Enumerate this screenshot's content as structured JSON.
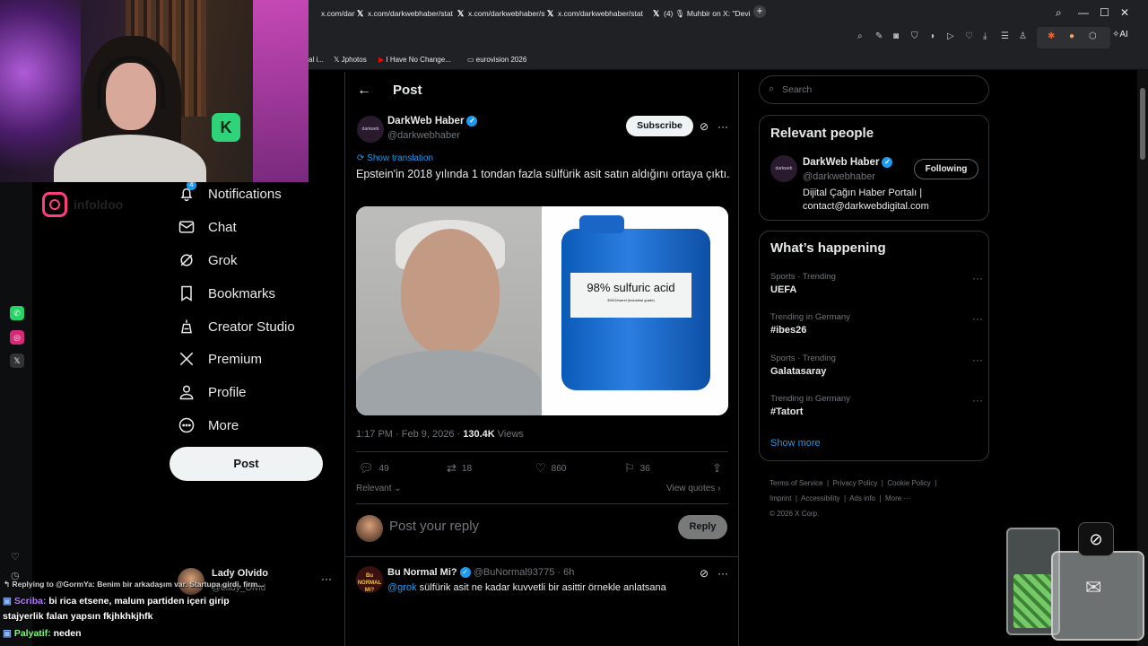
{
  "browser": {
    "tabs": [
      {
        "label": "x.com/darkwebhaber/stat"
      },
      {
        "label": "x.com/darkwebhaber/stat"
      },
      {
        "label": "x.com/darkwebhaber/stat"
      },
      {
        "label": "x.com/darkwebhaber/stat"
      },
      {
        "label": "(4) 🎙 Muhbir on X: \"Devi"
      }
    ],
    "bookmarks": [
      "al i...",
      "Jphotos",
      "I Have No Change...",
      "eurovision 2026"
    ],
    "ai_label": "AI"
  },
  "nav": {
    "notifications": "Notifications",
    "notifications_badge": "4",
    "chat": "Chat",
    "grok": "Grok",
    "bookmarks": "Bookmarks",
    "creator_studio": "Creator Studio",
    "premium": "Premium",
    "profile": "Profile",
    "more": "More",
    "post_button": "Post"
  },
  "me": {
    "name": "Lady Olvido",
    "handle": "@Lady_Olvid"
  },
  "page": {
    "title": "Post"
  },
  "tweet": {
    "author_name": "DarkWeb Haber",
    "author_handle": "@darkwebhaber",
    "avatar_text": "darkweb",
    "subscribe_label": "Subscribe",
    "show_translation": "Show translation",
    "text": "Epstein'in 2018 yılında 1 tondan fazla sülfürik asit satın aldığını ortaya çıktı.",
    "image_label_big": "98% sulfuric acid",
    "image_label_small": "35KG/barrel (industrial grade)",
    "time": "1:17 PM · Feb 9, 2026 · ",
    "views_count": "130.4K",
    "views_label": " Views",
    "replies": "49",
    "reposts": "18",
    "likes": "860",
    "bookmarks": "36",
    "sort_label": "Relevant",
    "view_quotes": "View quotes"
  },
  "reply_box": {
    "placeholder": "Post your reply",
    "button": "Reply"
  },
  "reply": {
    "name": "Bu Normal Mi?",
    "handle": "@BuNormal93775",
    "time": "· 6h",
    "mention": "@grok",
    "text": " sülfürik asit ne kadar kuvvetli bir asittir örnekle anlatsana",
    "avatar_text": "Bu NORMAL Mi?"
  },
  "sidebar_right": {
    "search_placeholder": "Search",
    "relevant_title": "Relevant people",
    "person_name": "DarkWeb Haber",
    "person_handle": "@darkwebhaber",
    "person_bio": "Dijital Çağın Haber Portalı | contact@darkwebdigital.com",
    "following_label": "Following",
    "happening_title": "What’s happening",
    "trends": [
      {
        "context": "Sports · Trending",
        "name": "UEFA"
      },
      {
        "context": "Trending in Germany",
        "name": "#ibes26"
      },
      {
        "context": "Sports · Trending",
        "name": "Galatasaray"
      },
      {
        "context": "Trending in Germany",
        "name": "#Tatort"
      }
    ],
    "show_more": "Show more",
    "footer": [
      "Terms of Service",
      "Privacy Policy",
      "Cookie Policy",
      "Imprint",
      "Accessibility",
      "Ads info",
      "More ···",
      "© 2026 X Corp."
    ]
  },
  "stream": {
    "instagram_name": "infoldoo",
    "replying": "Replying to @GormYa: Benim bir arkadaşım var. Startupa girdi, firm...",
    "chat": [
      {
        "user": "Scriba:",
        "message": " bi rica etsene, malum partiden içeri girip"
      },
      {
        "user": "",
        "message": "stajyerlik falan yapsın fkjhkhkjhfk"
      },
      {
        "user": "Palyatif:",
        "message": " neden"
      }
    ]
  }
}
